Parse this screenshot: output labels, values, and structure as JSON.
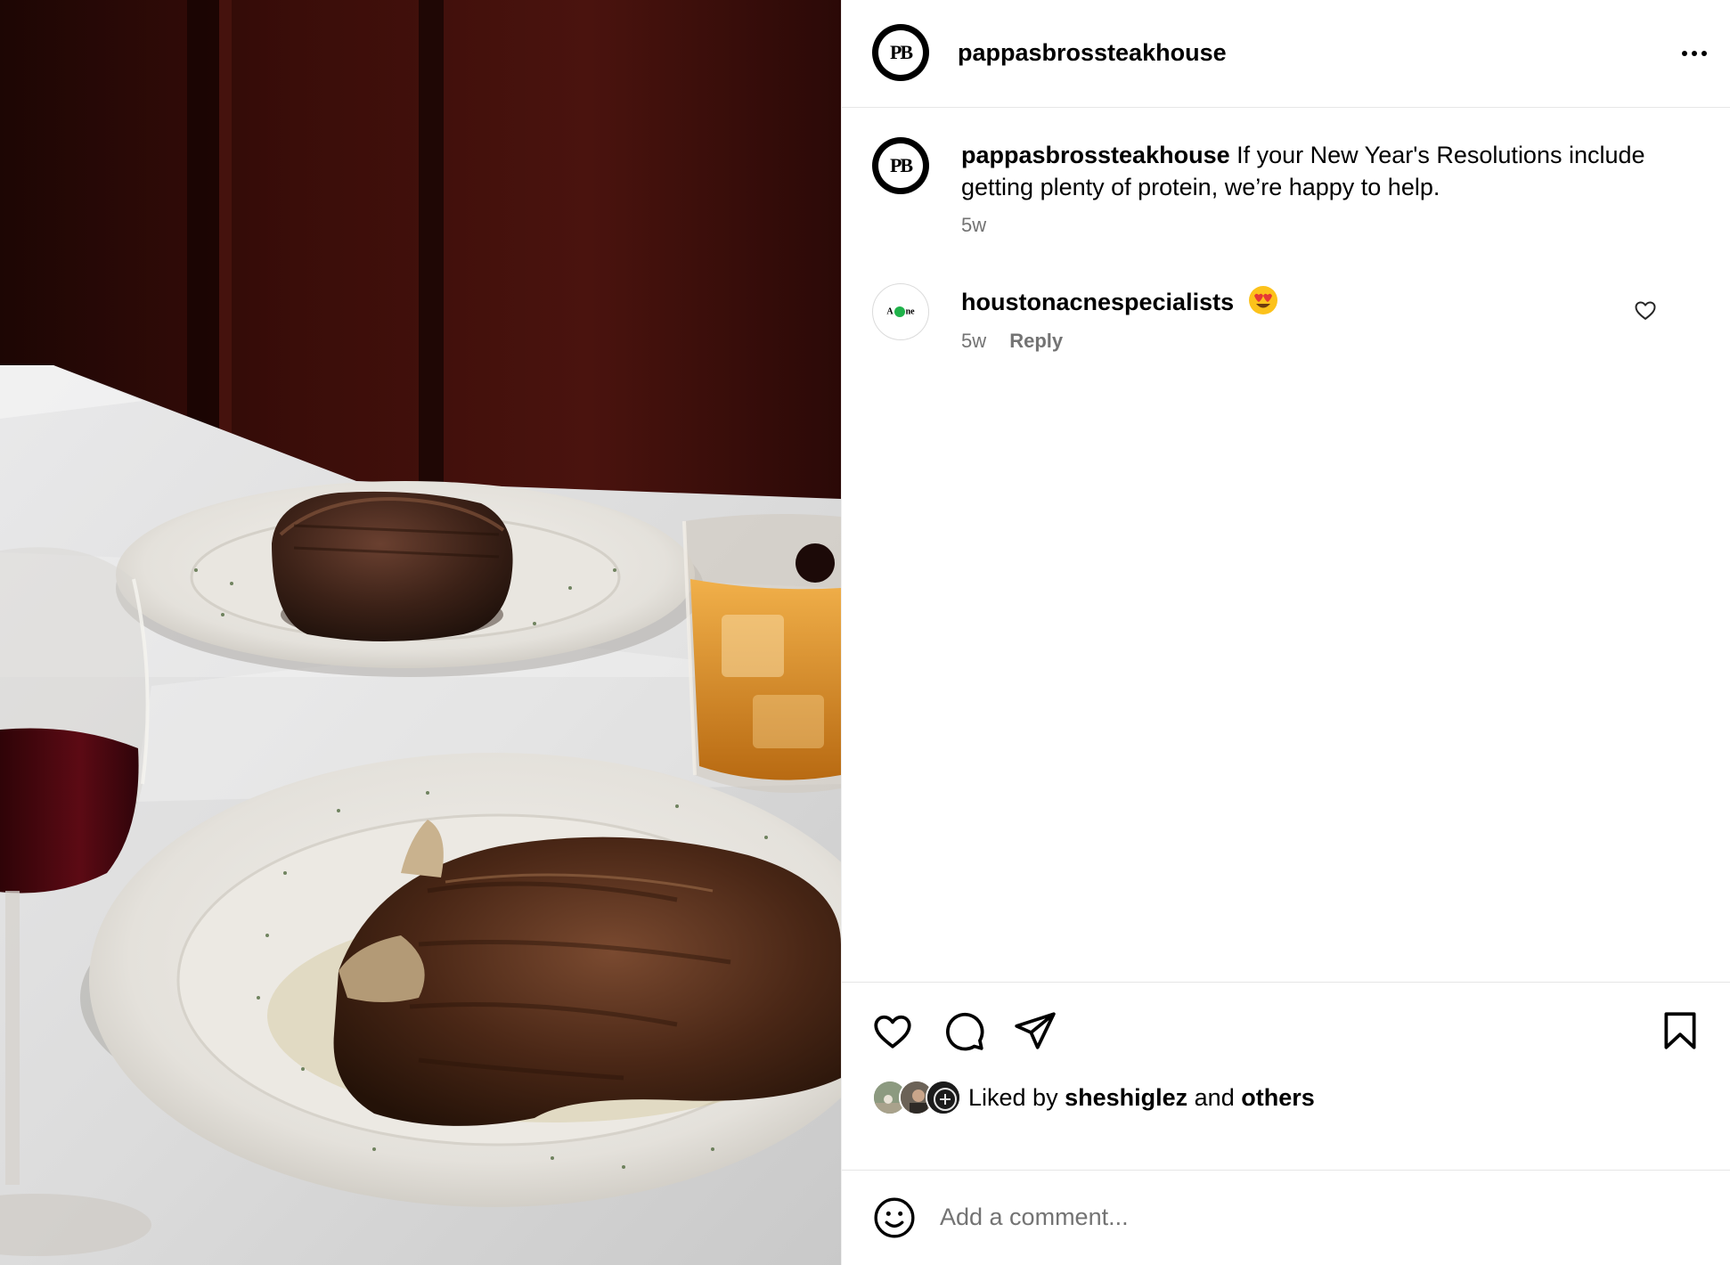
{
  "post": {
    "author": {
      "username": "pappasbrossteakhouse",
      "avatar_initials": "PB",
      "avatar_icon": "pb-monogram-logo"
    },
    "media": {
      "kind": "photo",
      "subject": "steak-dinner-photo"
    },
    "header": {
      "more_icon": "more-options-icon"
    },
    "caption": {
      "username": "pappasbrossteakhouse",
      "text": "If your New Year's Resolutions include getting plenty of protein, we’re happy to help.",
      "age": "5w"
    },
    "comments": [
      {
        "username": "houstonacnespecialists",
        "emoji": "😍",
        "emoji_icon": "heart-eyes-emoji-icon",
        "age": "5w",
        "reply_label": "Reply",
        "avatar_text": "A ne"
      }
    ],
    "actions": {
      "like_icon": "heart-icon",
      "comment_icon": "comment-icon",
      "share_icon": "share-icon",
      "save_icon": "bookmark-icon"
    },
    "likes": {
      "prefix": "Liked by",
      "first_user": "sheshiglez",
      "connector": "and",
      "others": "others"
    },
    "composer": {
      "placeholder": "Add a comment...",
      "emoji_icon": "smiley-icon"
    }
  },
  "colors": {
    "text_primary": "#000000",
    "text_secondary": "#737373",
    "divider": "#e6e6e6",
    "background": "#ffffff"
  }
}
